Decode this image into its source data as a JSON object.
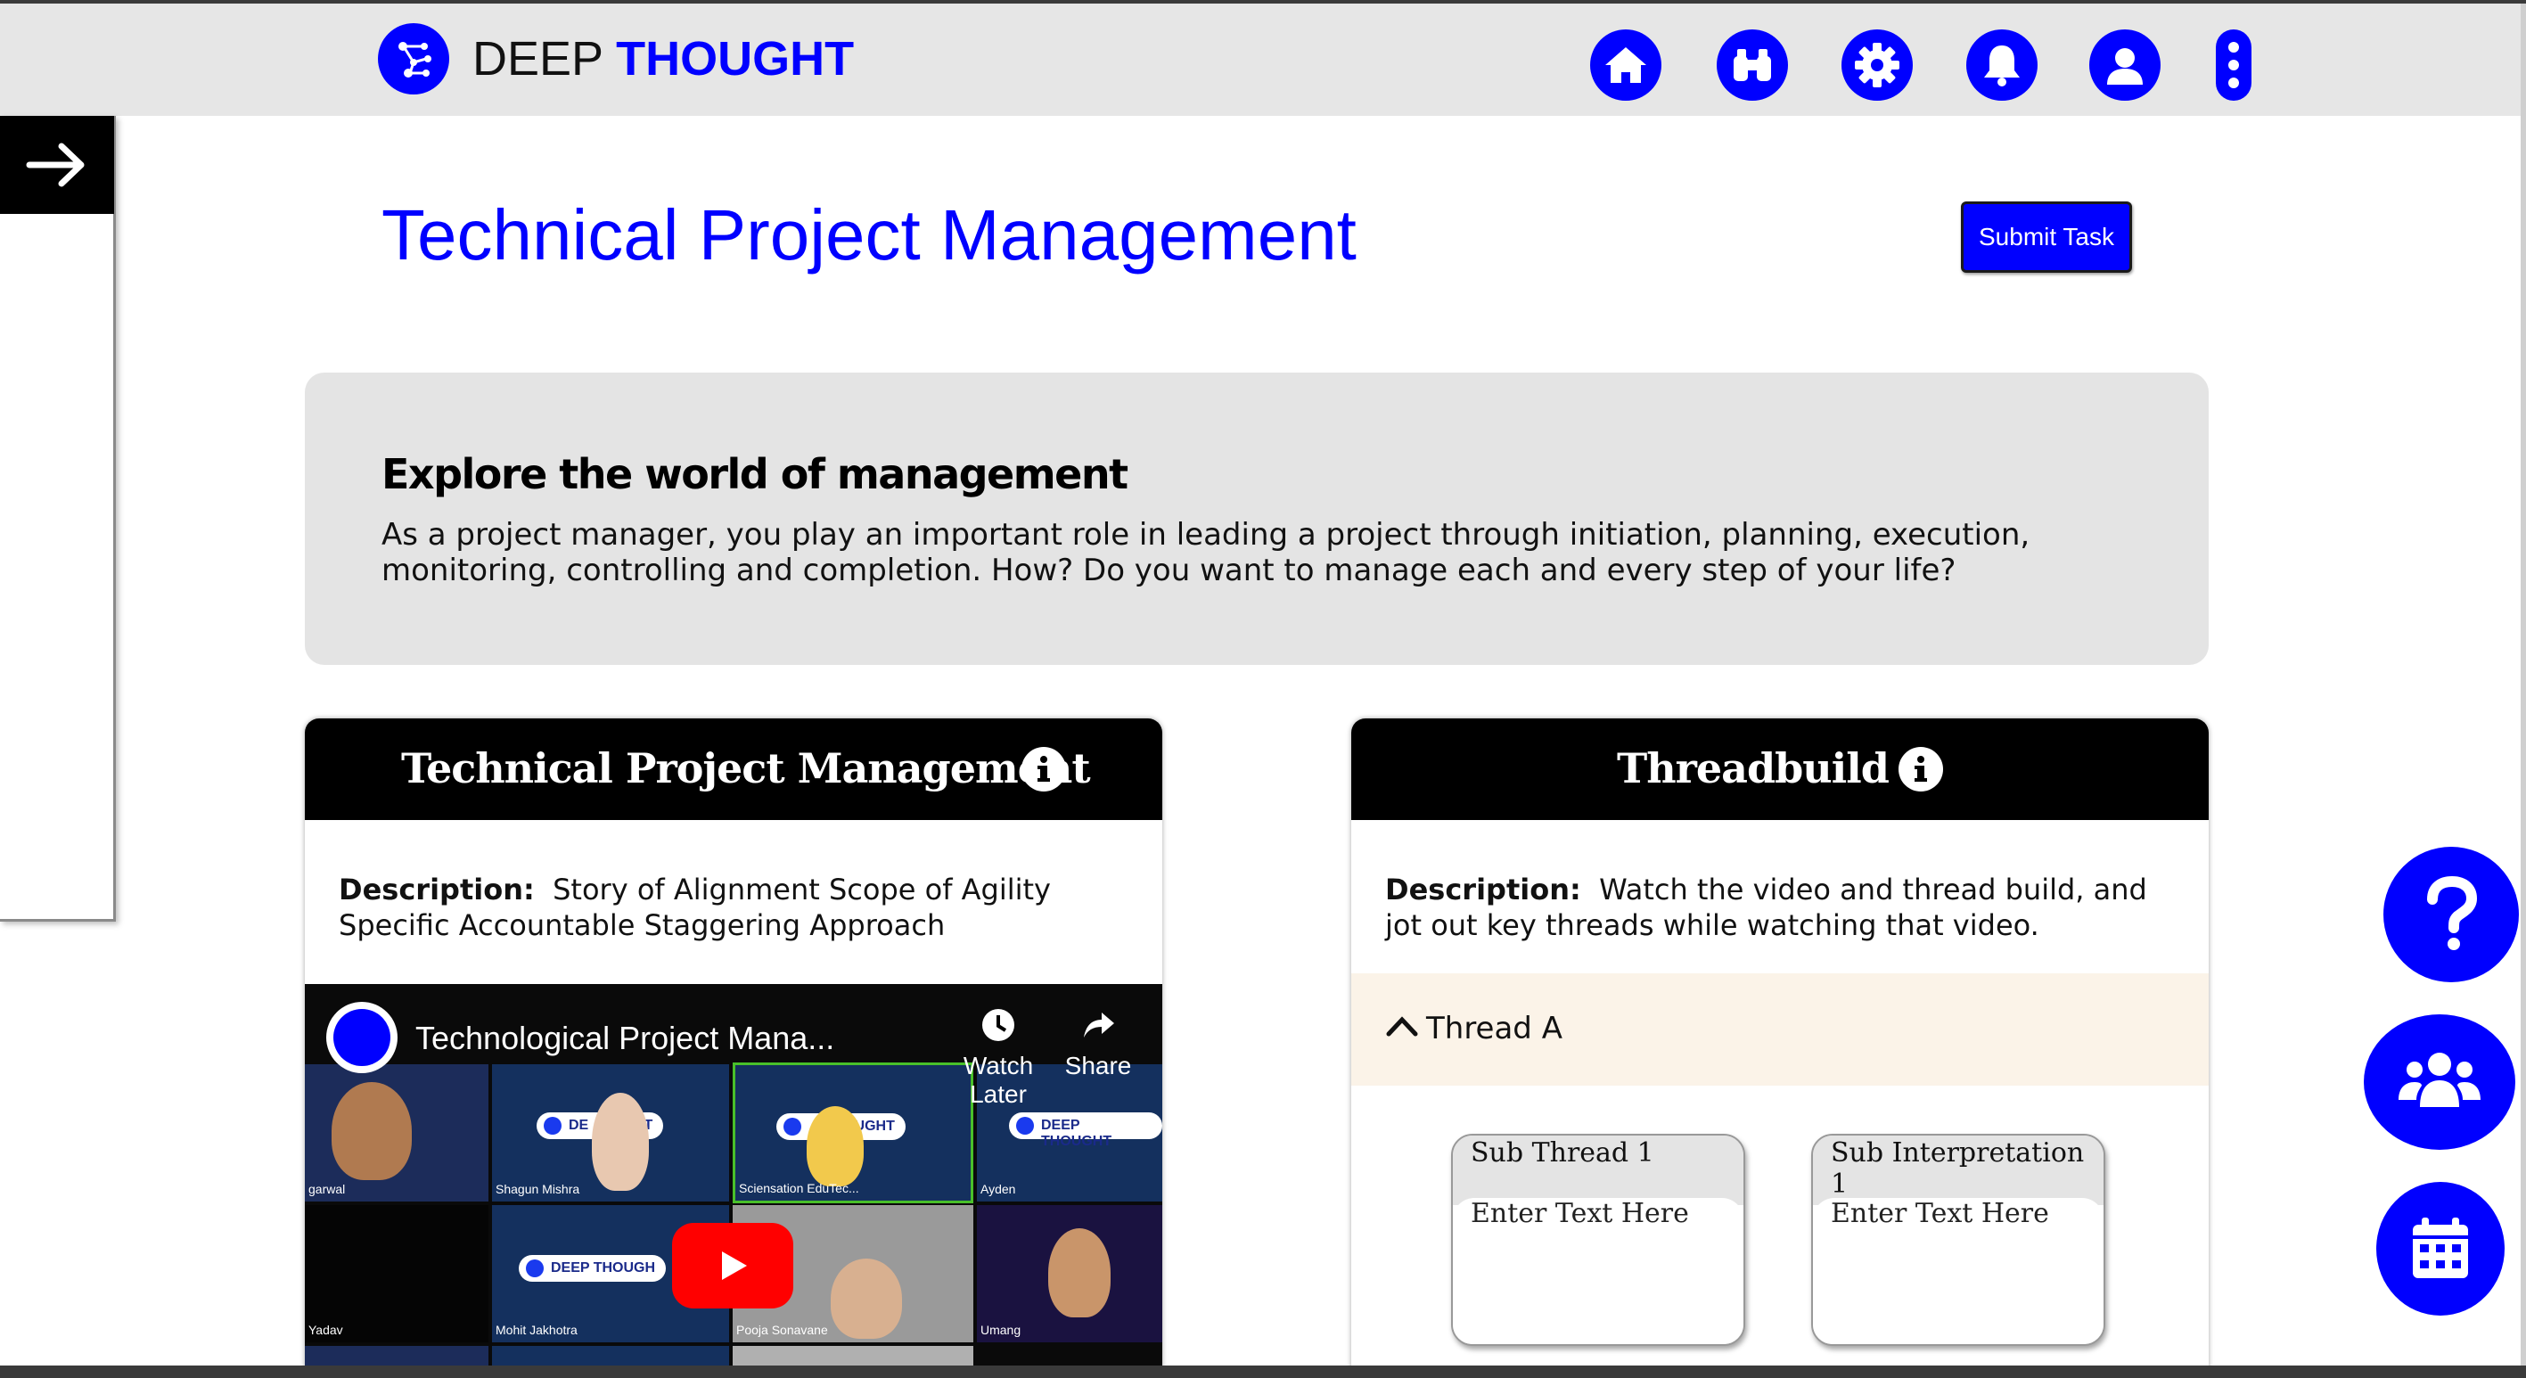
{
  "brand": {
    "part1": "DEEP",
    "part2": "THOUGHT"
  },
  "nav": {
    "icons": [
      "home-icon",
      "binoculars-icon",
      "gear-icon",
      "bell-icon",
      "user-icon",
      "more-vertical-icon"
    ]
  },
  "page": {
    "title": "Technical Project Management",
    "submit_label": "Submit Task"
  },
  "intro": {
    "heading": "Explore the world of management",
    "body": "As a project manager, you play an important role in leading a project through initiation, planning, execution, monitoring, controlling and completion. How? Do you want to manage each and every step of your life?"
  },
  "card_video": {
    "title": "Technical Project Management",
    "desc_label": "Description:",
    "desc_text": "Story of Alignment Scope of Agility Specific Accountable Staggering Approach",
    "video": {
      "title": "Technological Project Mana...",
      "watch_later": "Watch Later",
      "share": "Share",
      "participants": [
        "garwal",
        "Shagun Mishra",
        "Sciensation EduTec...",
        "Ayden",
        "Yadav",
        "Mohit Jakhotra",
        "Pooja Sonavane",
        "Umang"
      ],
      "badge_text": "DEEP THOUGHT",
      "badge_short_1": "DE",
      "badge_short_2": "UGHT",
      "badge_short_3": "THOUGHT",
      "badge_short_4": "DEEP THOUGH"
    }
  },
  "card_thread": {
    "title": "Threadbuild",
    "desc_label": "Description:",
    "desc_text": "Watch the video and thread build, and jot out key threads while watching that video.",
    "thread_label": "Thread A",
    "sub_thread": {
      "header": "Sub Thread 1",
      "placeholder": "Enter Text Here"
    },
    "sub_interp": {
      "header": "Sub Interpretation 1",
      "placeholder": "Enter Text Here"
    }
  },
  "colors": {
    "accent": "#0000ff",
    "panel": "#e4e4e4",
    "thread_bg": "#fbf3e8"
  },
  "fabs": [
    "help-icon",
    "team-icon",
    "calendar-icon"
  ]
}
